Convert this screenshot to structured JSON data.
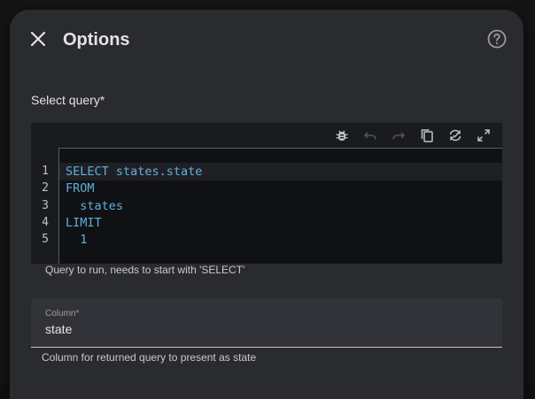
{
  "dialog": {
    "title": "Options",
    "close_icon": "close-icon",
    "help_icon": "help-circle-icon"
  },
  "query": {
    "label": "Select query*",
    "toolbar": [
      {
        "name": "debug-icon",
        "enabled": true
      },
      {
        "name": "undo-icon",
        "enabled": false
      },
      {
        "name": "redo-icon",
        "enabled": false
      },
      {
        "name": "copy-icon",
        "enabled": true
      },
      {
        "name": "refresh-icon",
        "enabled": true
      },
      {
        "name": "fullscreen-icon",
        "enabled": true
      }
    ],
    "lines": [
      {
        "num": "1",
        "text": "SELECT states.state"
      },
      {
        "num": "2",
        "text": "FROM"
      },
      {
        "num": "3",
        "text": "  states"
      },
      {
        "num": "4",
        "text": "LIMIT"
      },
      {
        "num": "5",
        "text": "  1"
      }
    ],
    "active_line": 1,
    "helper": "Query to run, needs to start with 'SELECT'"
  },
  "column": {
    "label": "Column*",
    "value": "state",
    "helper": "Column for returned query to present as state"
  },
  "colors": {
    "dialog_bg": "#2a2b2f",
    "code_keyword": "#5fb0d9",
    "field_bg": "#323338"
  }
}
